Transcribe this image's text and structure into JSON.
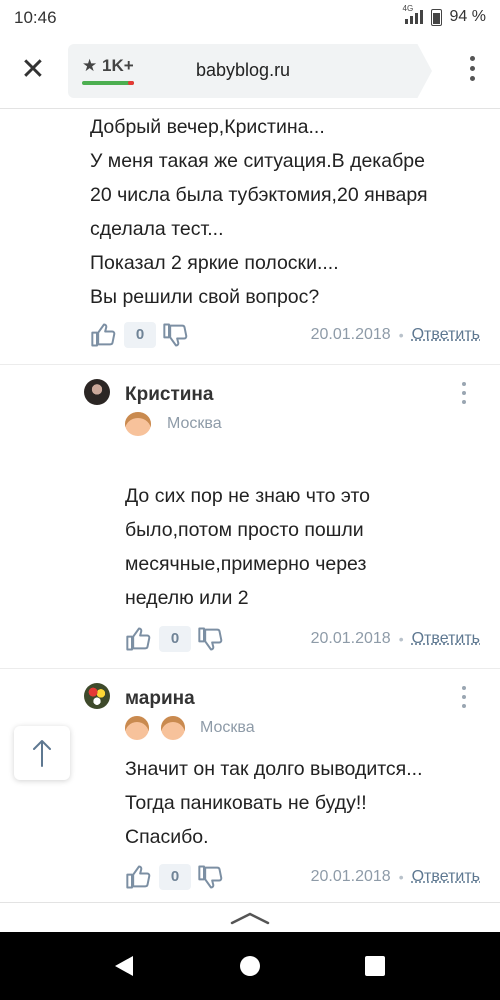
{
  "status": {
    "time": "10:46",
    "network": "4G",
    "battery": "94 %"
  },
  "browser": {
    "rating": "1K+",
    "url": "babyblog.ru"
  },
  "comments": [
    {
      "text_lines": [
        "Добрый вечер,Кристина...",
        "У меня такая же ситуация.В декабре",
        "20 числа была тубэктомия,20 января",
        "сделала тест...",
        "Показал 2 яркие полоски....",
        "Вы решили свой вопрос?"
      ],
      "votes": "0",
      "date": "20.01.2018",
      "reply_label": "Ответить"
    },
    {
      "author": "Кристина",
      "city": "Москва",
      "text_lines": [
        "До сих пор не знаю что это",
        "было,потом просто пошли",
        "месячные,примерно через",
        "неделю или 2"
      ],
      "votes": "0",
      "date": "20.01.2018",
      "reply_label": "Ответить"
    },
    {
      "author": "марина",
      "city": "Москва",
      "text_lines": [
        "Значит он так долго выводится...",
        "Тогда паниковать не буду!!",
        "Спасибо."
      ],
      "votes": "0",
      "date": "20.01.2018",
      "reply_label": "Ответить"
    }
  ],
  "colors": {
    "accent": "#5e7891",
    "muted": "#8e9ba8",
    "rating_green": "#4caf50"
  },
  "icons": [
    "close-icon",
    "star-icon",
    "menu-icon",
    "thumb-up-icon",
    "thumb-down-icon",
    "scroll-up-icon",
    "chevron-up-icon",
    "back-icon",
    "home-icon",
    "recents-icon"
  ]
}
